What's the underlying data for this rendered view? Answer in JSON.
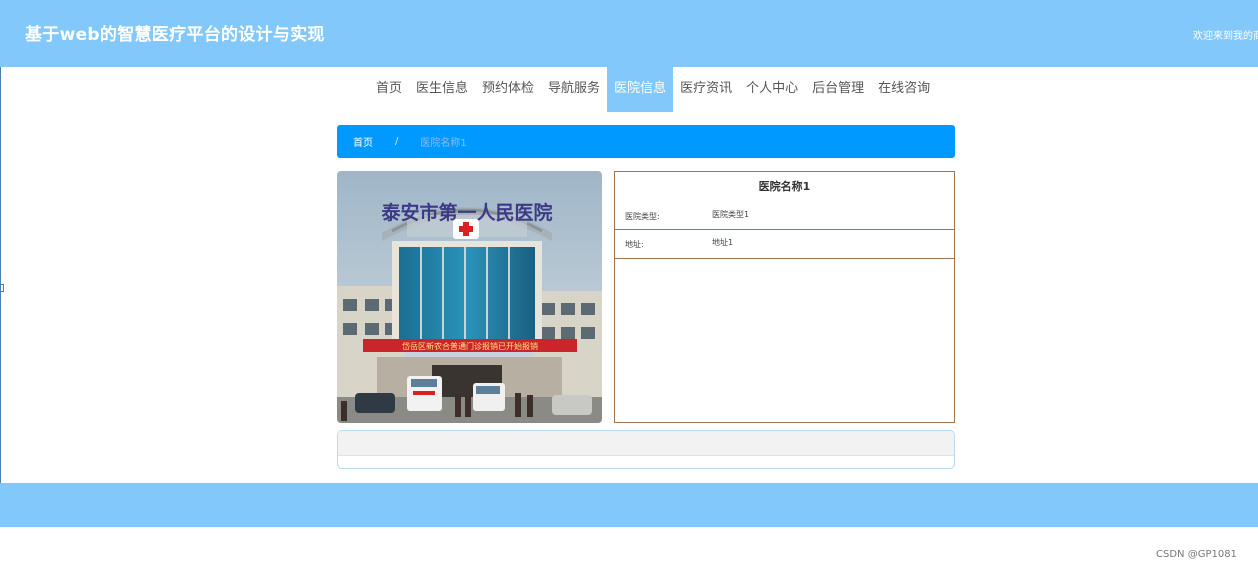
{
  "header": {
    "site_title": "基于web的智慧医疗平台的设计与实现",
    "welcome_text": "欢迎来到我的商"
  },
  "nav": {
    "items": [
      {
        "label": "首页"
      },
      {
        "label": "医生信息"
      },
      {
        "label": "预约体检"
      },
      {
        "label": "导航服务"
      },
      {
        "label": "医院信息",
        "active": true
      },
      {
        "label": "医疗资讯"
      },
      {
        "label": "个人中心"
      },
      {
        "label": "后台管理"
      },
      {
        "label": "在线咨询"
      }
    ]
  },
  "breadcrumb": {
    "home": "首页",
    "separator": "/",
    "current": "医院名称1"
  },
  "detail": {
    "photo_icon": "hospital-building-photo",
    "sign_text": "泰安市第一人民医院",
    "banner_text": "岱岳区新农合普通门诊报销已开始报销",
    "title": "医院名称1",
    "rows": [
      {
        "label": "医院类型:",
        "value": "医院类型1"
      },
      {
        "label": "地址:",
        "value": "地址1"
      }
    ]
  },
  "watermark": "CSDN @GP1081",
  "colors": {
    "header_bg": "#83c8fb",
    "breadcrumb_bg": "#0099ff",
    "info_border": "#a0744e"
  }
}
